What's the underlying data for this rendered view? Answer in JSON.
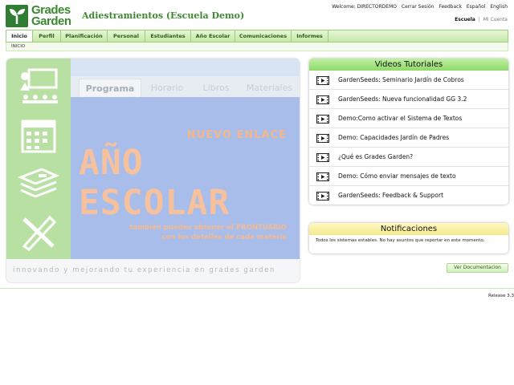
{
  "header": {
    "logo_line1": "Grades",
    "logo_line2": "Garden",
    "school_title": "Adiestramientos (Escuela Demo)",
    "welcome": "Welcome: DIRECTORDEMO",
    "logout": "Cerrar Sesión",
    "feedback": "Feedback",
    "lang_es": "Español",
    "lang_en": "English",
    "context_active": "Escuela",
    "context_sep": "|",
    "context_other": "Mi Cuenta"
  },
  "nav": {
    "items": [
      "Inicio",
      "Perfil",
      "Planificación",
      "Personal",
      "Estudiantes",
      "Año Escolar",
      "Comunicaciones",
      "Informes"
    ],
    "active_index": 0
  },
  "breadcrumb": "INICIO",
  "banner": {
    "tabs": [
      "Programa",
      "Horario",
      "Libros",
      "Materiales"
    ],
    "new_link": "NUEVO ENLACE",
    "big_title": "AÑO ESCOLAR",
    "sub_line1": "también puedes obtener el PRONTUARIO",
    "sub_line2": "con los detalles de cada materia",
    "footer": "innovando y mejorando tu experiencia en grades garden"
  },
  "videos": {
    "title": "Videos Tutoriales",
    "items": [
      "GardenSeeds: Seminario Jardín de Cobros",
      "GardenSeeds: Nueva funcionalidad GG 3.2",
      "Demo:Como activar el Sistema de Textos",
      "Demo: Capacidades Jardín de Padres",
      "¿Qué es Grades Garden?",
      "Demo: Cómo enviar mensajes de texto",
      "GardenSeeds: Feedback & Support"
    ]
  },
  "notifications": {
    "title": "Notificaciones",
    "message": "Todos los sistemas estables. No hay asuntos que reportar en este momento."
  },
  "doc_button": "Ver Documentacion",
  "release": "Release 3.3",
  "colors": {
    "brand_green": "#3a8a2e",
    "nav_green": "#c6e8a9",
    "video_head": "#8ed96a",
    "notif_head": "#f4ea8a"
  }
}
